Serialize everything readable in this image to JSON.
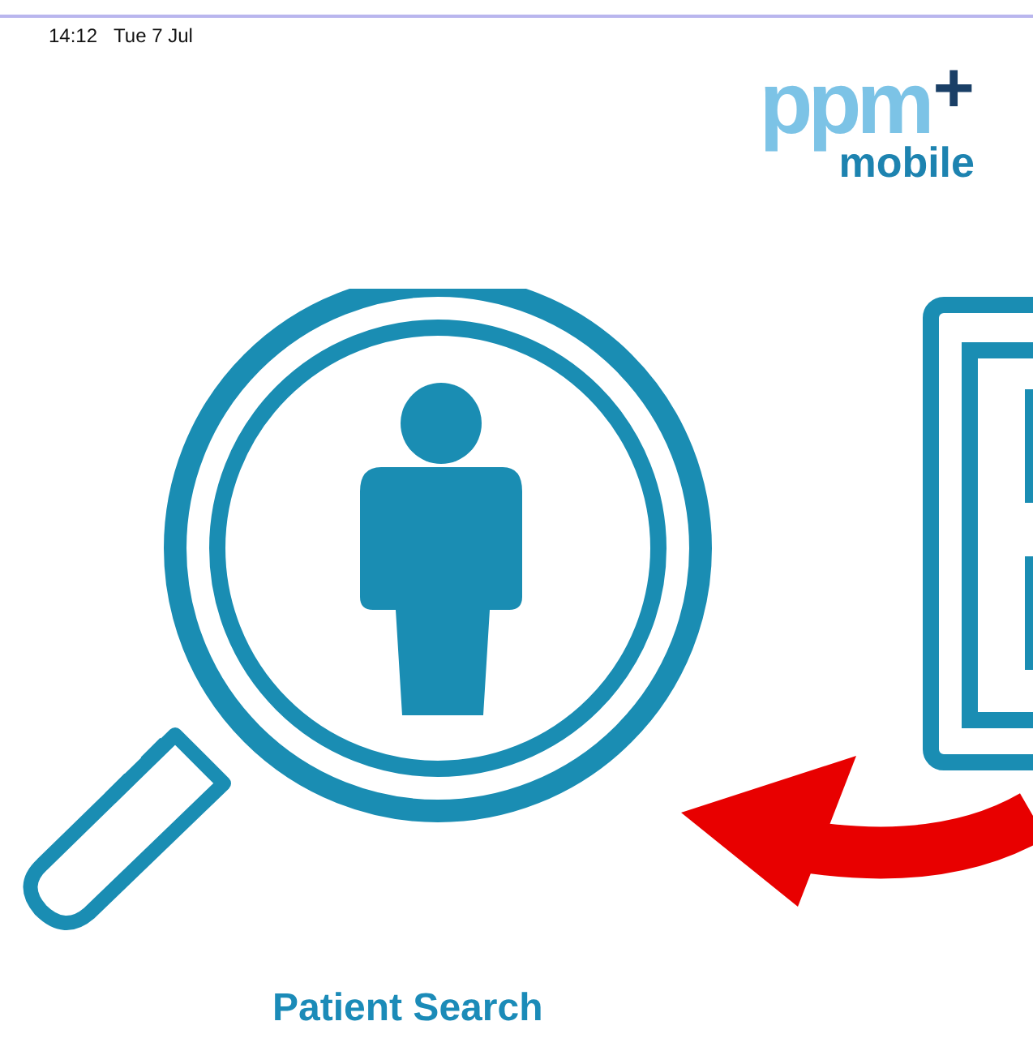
{
  "status_bar": {
    "time": "14:12",
    "date": "Tue 7 Jul"
  },
  "logo": {
    "main": "ppm",
    "plus": "+",
    "sub": "mobile"
  },
  "tiles": [
    {
      "label": "Patient Search"
    }
  ]
}
